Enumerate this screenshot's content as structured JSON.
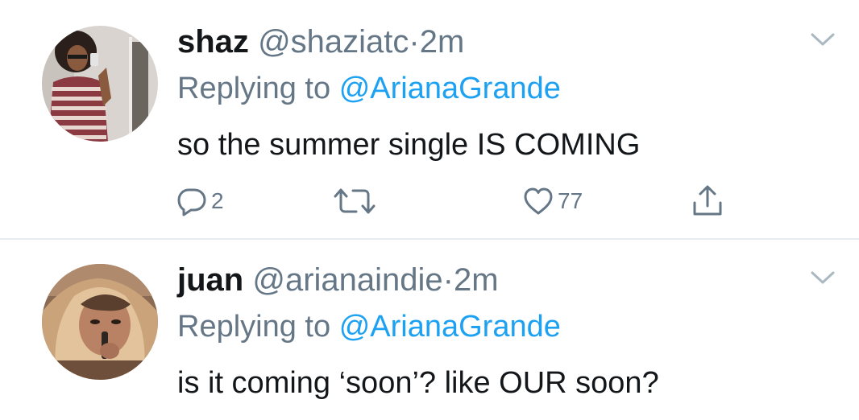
{
  "tweets": [
    {
      "display_name": "shaz",
      "handle": "@shaziatc",
      "separator": "·",
      "time": "2m",
      "replying_prefix": "Replying to",
      "replying_to": "@ArianaGrande",
      "text": "so the summer single IS COMING",
      "reply_count": "2",
      "like_count": "77"
    },
    {
      "display_name": "juan",
      "handle": "@arianaindie",
      "separator": "·",
      "time": "2m",
      "replying_prefix": "Replying to",
      "replying_to": "@ArianaGrande",
      "text": "is it coming ‘soon’? like OUR soon?"
    }
  ],
  "icons": {
    "reply": "reply-icon",
    "retweet": "retweet-icon",
    "like": "heart-icon",
    "share": "share-icon",
    "menu": "chevron-down-icon"
  },
  "colors": {
    "text": "#14171a",
    "secondary": "#657786",
    "link": "#1da1f2",
    "divider": "#e6ecf0",
    "background": "#ffffff"
  }
}
